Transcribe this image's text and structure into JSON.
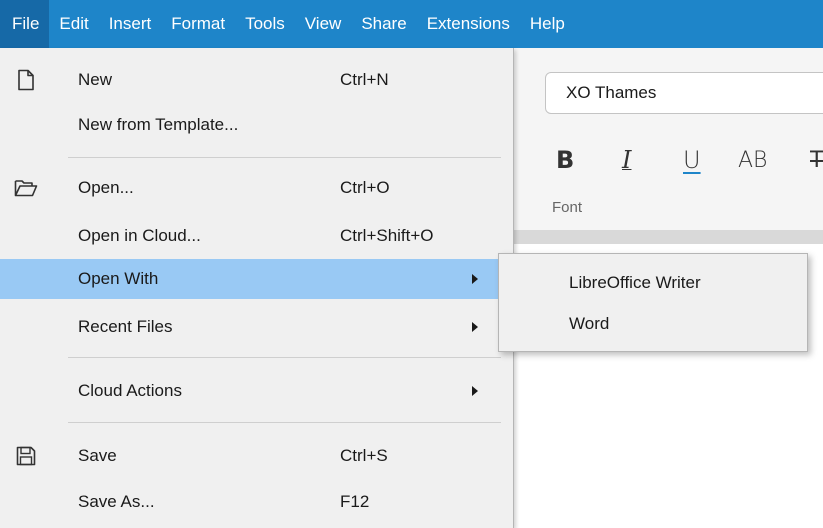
{
  "menubar": {
    "items": [
      {
        "label": "File",
        "active": true
      },
      {
        "label": "Edit"
      },
      {
        "label": "Insert"
      },
      {
        "label": "Format"
      },
      {
        "label": "Tools"
      },
      {
        "label": "View"
      },
      {
        "label": "Share"
      },
      {
        "label": "Extensions"
      },
      {
        "label": "Help"
      }
    ]
  },
  "toolbar": {
    "font_name": "XO Thames",
    "bold": "B",
    "italic": "I",
    "underline": "U",
    "allcaps": "AB",
    "font_group_label": "Font"
  },
  "file_menu": {
    "items": [
      {
        "label": "New",
        "shortcut": "Ctrl+N",
        "icon": "new-document-icon"
      },
      {
        "label": "New from Template...",
        "shortcut": ""
      },
      {
        "label": "Open...",
        "shortcut": "Ctrl+O",
        "icon": "open-folder-icon"
      },
      {
        "label": "Open in Cloud...",
        "shortcut": "Ctrl+Shift+O"
      },
      {
        "label": "Open With",
        "shortcut": "",
        "submenu": true,
        "highlighted": true
      },
      {
        "label": "Recent Files",
        "shortcut": "",
        "submenu": true
      },
      {
        "label": "Cloud Actions",
        "shortcut": "",
        "submenu": true
      },
      {
        "label": "Save",
        "shortcut": "Ctrl+S",
        "icon": "save-icon"
      },
      {
        "label": "Save As...",
        "shortcut": "F12"
      }
    ]
  },
  "open_with_submenu": {
    "items": [
      {
        "label": "LibreOffice Writer"
      },
      {
        "label": "Word"
      }
    ]
  },
  "colors": {
    "menubar_bg": "#1e85c9",
    "menubar_active": "#1669a7",
    "menu_bg": "#f0f0f0",
    "highlight": "#99c9f4"
  }
}
